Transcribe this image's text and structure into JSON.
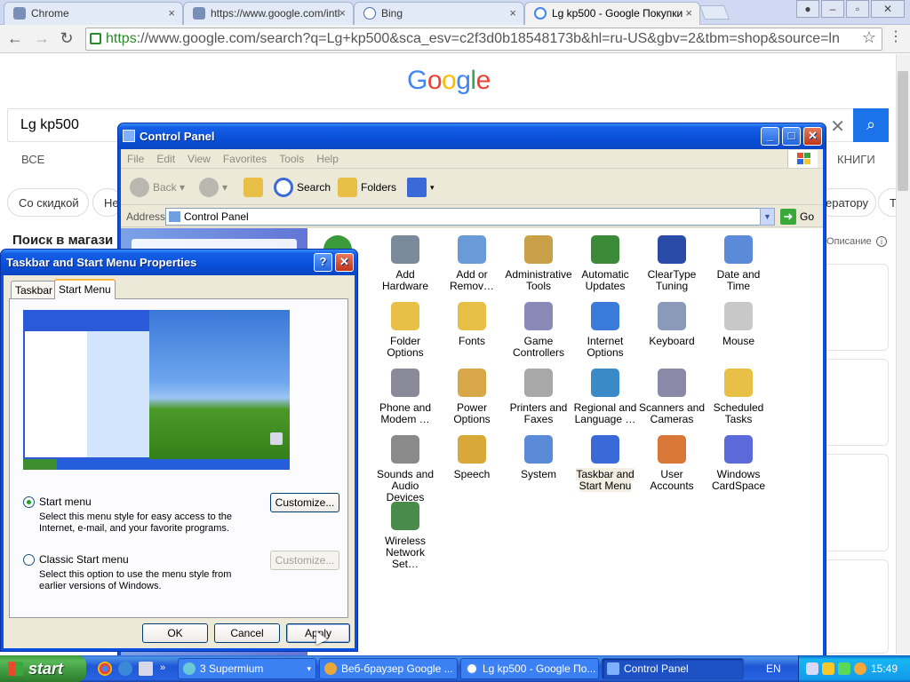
{
  "browser": {
    "tabs": [
      {
        "title": "Chrome",
        "close": "×"
      },
      {
        "title": "https://www.google.com/intl",
        "close": "×"
      },
      {
        "title": "Bing",
        "close": "×"
      },
      {
        "title": "Lg kp500 - Google Покупки",
        "close": "×"
      }
    ],
    "url_scheme": "https",
    "url_rest": "://www.google.com/search?q=Lg+kp500&sca_esv=c2f3d0b18548173b&hl=ru-US&gbv=2&tbm=shop&source=ln"
  },
  "google": {
    "logo": "Google",
    "query": "Lg kp500",
    "tabs": {
      "all": "ВСЕ",
      "books": "КНИГИ"
    },
    "chips": [
      "Со скидкой",
      "Не",
      "ератору",
      "Т"
    ],
    "shopping_heading": "Поиск в магази",
    "description_label": "Описание"
  },
  "control_panel": {
    "title": "Control Panel",
    "menu": [
      "File",
      "Edit",
      "View",
      "Favorites",
      "Tools",
      "Help"
    ],
    "toolbar": {
      "back": "Back",
      "search": "Search",
      "folders": "Folders"
    },
    "address_label": "Address",
    "address_value": "Control Panel",
    "go_label": "Go",
    "partial_labels": {
      "access": "ty",
      "ns": "ns",
      "s": "s"
    },
    "items": [
      {
        "label": "Add Hardware",
        "icon": "add-hardware-icon",
        "color": "#7a8a9a"
      },
      {
        "label": "Add or Remov…",
        "icon": "add-remove-programs-icon",
        "color": "#6a9ad8"
      },
      {
        "label": "Administrative Tools",
        "icon": "administrative-tools-icon",
        "color": "#c8a048"
      },
      {
        "label": "Automatic Updates",
        "icon": "windows-logo-icon",
        "color": "#3a8a3a"
      },
      {
        "label": "ClearType Tuning",
        "icon": "cleartype-icon",
        "color": "#2a4aa8"
      },
      {
        "label": "Date and Time",
        "icon": "clock-icon",
        "color": "#5a8ad8"
      },
      {
        "label": "Folder Options",
        "icon": "folder-icon",
        "color": "#e8c048"
      },
      {
        "label": "Fonts",
        "icon": "fonts-folder-icon",
        "color": "#e8c048"
      },
      {
        "label": "Game Controllers",
        "icon": "gamepad-icon",
        "color": "#8a8ab8"
      },
      {
        "label": "Internet Options",
        "icon": "globe-icon",
        "color": "#3a7ad8"
      },
      {
        "label": "Keyboard",
        "icon": "keyboard-icon",
        "color": "#8a9ab8"
      },
      {
        "label": "Mouse",
        "icon": "mouse-icon",
        "color": "#c8c8c8"
      },
      {
        "label": "Phone and Modem …",
        "icon": "phone-icon",
        "color": "#8a8a9a"
      },
      {
        "label": "Power Options",
        "icon": "power-icon",
        "color": "#d8a848"
      },
      {
        "label": "Printers and Faxes",
        "icon": "printer-icon",
        "color": "#a8a8a8"
      },
      {
        "label": "Regional and Language …",
        "icon": "globe-icon",
        "color": "#3a8ac8"
      },
      {
        "label": "Scanners and Cameras",
        "icon": "scanner-icon",
        "color": "#8a8aa8"
      },
      {
        "label": "Scheduled Tasks",
        "icon": "scheduled-tasks-icon",
        "color": "#e8c048"
      },
      {
        "label": "Sounds and Audio Devices",
        "icon": "speaker-icon",
        "color": "#8a8a8a"
      },
      {
        "label": "Speech",
        "icon": "speech-icon",
        "color": "#d8a838"
      },
      {
        "label": "System",
        "icon": "computer-icon",
        "color": "#5a8ad8"
      },
      {
        "label": "Taskbar and Start Menu",
        "icon": "taskbar-icon",
        "color": "#3a6ad8"
      },
      {
        "label": "User Accounts",
        "icon": "users-icon",
        "color": "#d87838"
      },
      {
        "label": "Windows CardSpace",
        "icon": "cardspace-icon",
        "color": "#5a6ad8"
      },
      {
        "label": "Wireless Network Set…",
        "icon": "wireless-icon",
        "color": "#4a8a4a"
      }
    ]
  },
  "dialog": {
    "title": "Taskbar and Start Menu Properties",
    "tabs": [
      "Taskbar",
      "Start Menu"
    ],
    "start_menu_label": "Start menu",
    "start_menu_desc": "Select this menu style for easy access to the Internet, e-mail, and your favorite programs.",
    "classic_label": "Classic Start menu",
    "classic_desc": "Select this option to use the menu style from earlier versions of Windows.",
    "customize": "Customize...",
    "ok": "OK",
    "cancel": "Cancel",
    "apply": "Apply"
  },
  "taskbar": {
    "start": "start",
    "buttons": [
      "3 Supermium",
      "Веб-браузер Google ...",
      "Lg kp500 - Google По...",
      "Control Panel"
    ],
    "lang": "EN",
    "clock": "15:49"
  }
}
